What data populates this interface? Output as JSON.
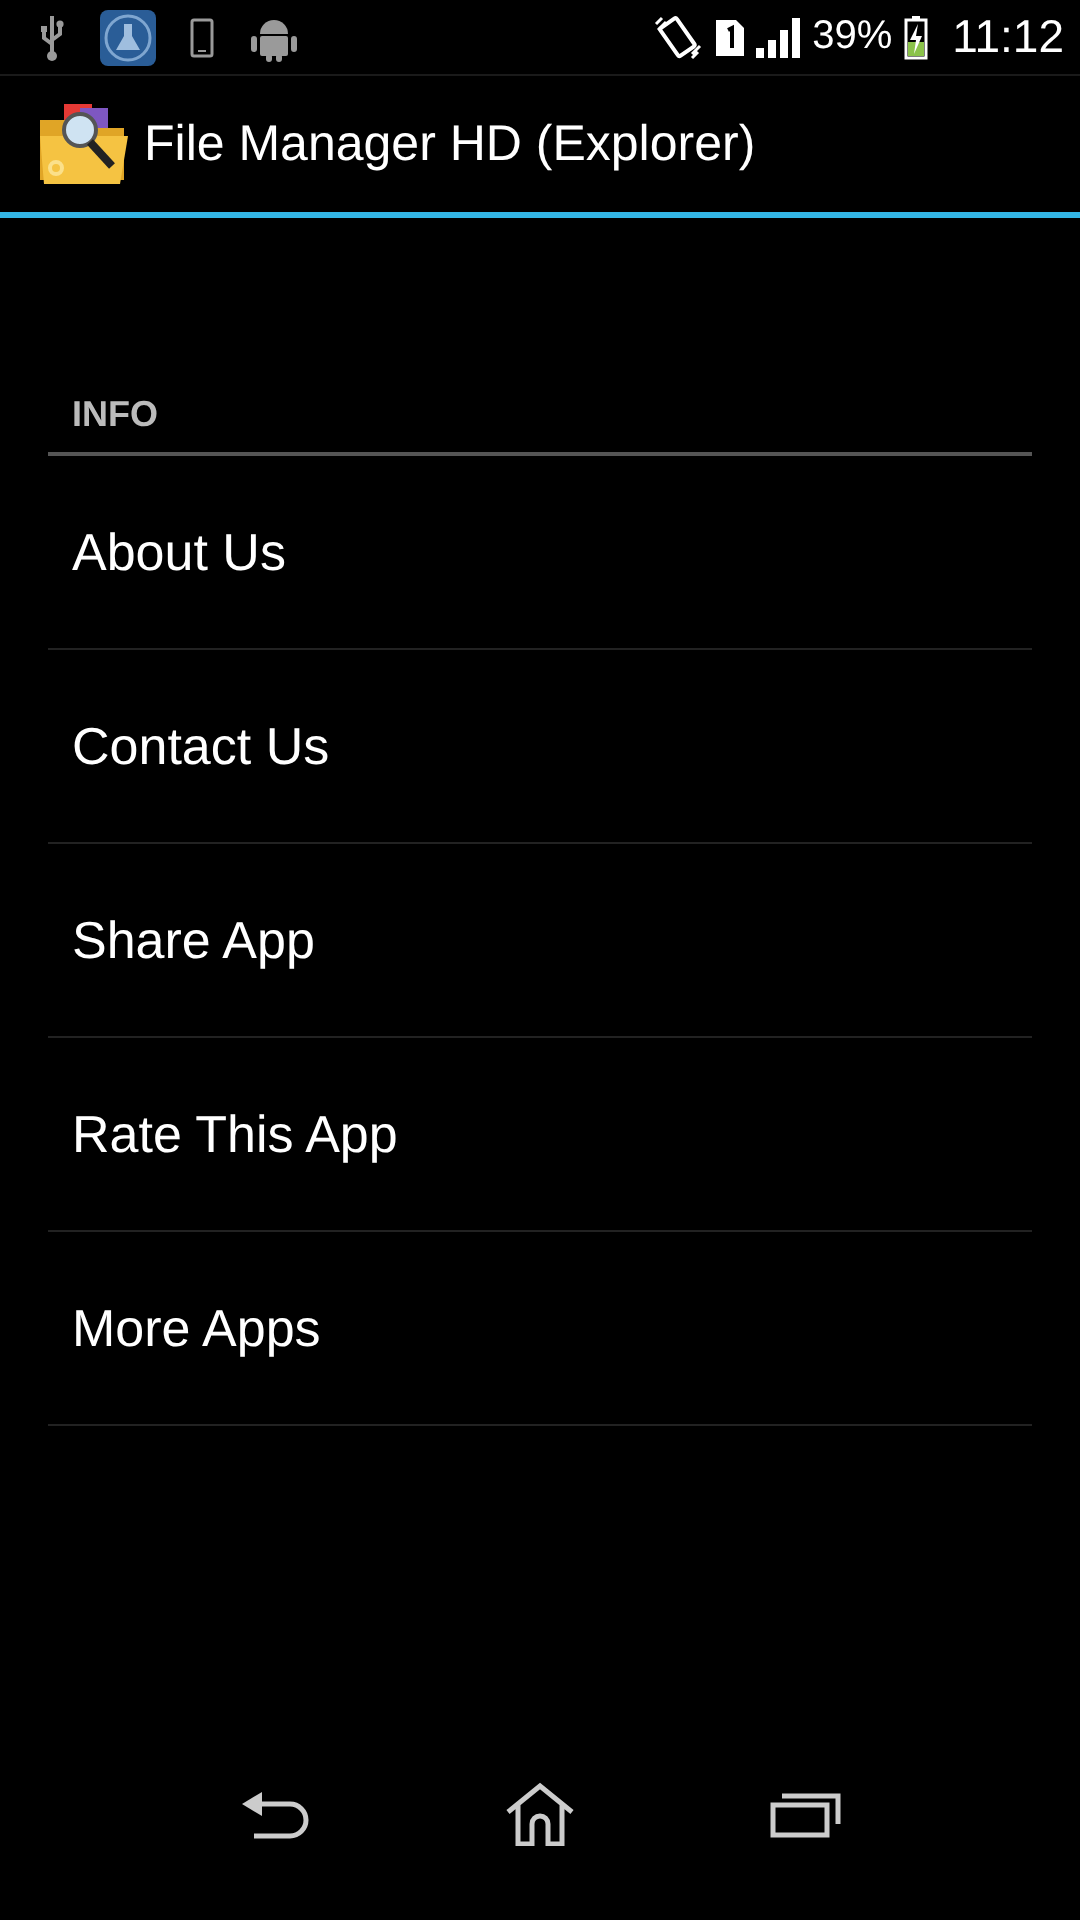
{
  "status_bar": {
    "battery": "39%",
    "time": "11:12"
  },
  "action_bar": {
    "title": "File Manager HD (Explorer)"
  },
  "section": {
    "header": "INFO",
    "items": [
      {
        "label": "About Us"
      },
      {
        "label": "Contact Us"
      },
      {
        "label": "Share App"
      },
      {
        "label": "Rate This App"
      },
      {
        "label": "More Apps"
      }
    ]
  }
}
